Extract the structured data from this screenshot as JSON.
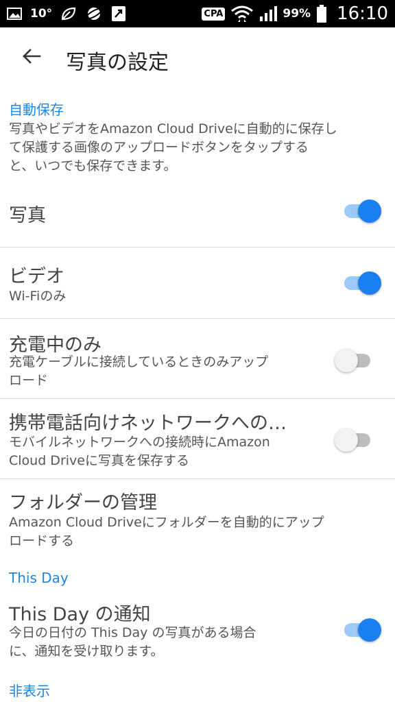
{
  "status_bar": {
    "temperature": "10°",
    "carrier": "CPA",
    "battery": "99%",
    "time": "16:10",
    "icons": [
      "image-icon",
      "leaf-icon",
      "planet-icon",
      "app-icon",
      "wifi-icon",
      "signal-icon",
      "battery-icon"
    ]
  },
  "toolbar": {
    "back_icon": "arrow-left-icon",
    "title": "写真の設定"
  },
  "auto_save": {
    "header": "自動保存",
    "description": "写真やビデオをAmazon Cloud Driveに自動的に保存して保護する画像のアップロードボタンをタップすると、いつでも保存できます。",
    "description_lines": [
      "写真やビデオをAmazon Cloud Driveに自動的に保存し",
      "て保護する画像のアップロードボタンをタップする",
      "と、いつでも保存できます。"
    ]
  },
  "settings": {
    "photos": {
      "title": "写真",
      "enabled": true
    },
    "video": {
      "title": "ビデオ",
      "subtitle": "Wi-Fiのみ",
      "enabled": true
    },
    "charging_only": {
      "title": "充電中のみ",
      "subtitle_lines": [
        "充電ケーブルに接続しているときのみアップ",
        "ロード"
      ],
      "enabled": false
    },
    "mobile_network": {
      "title": "携帯電話向けネットワークへの…",
      "subtitle_lines": [
        "モバイルネットワークへの接続時にAmazon",
        "Cloud Driveに写真を保存する"
      ],
      "enabled": false
    },
    "folder_management": {
      "title": "フォルダーの管理",
      "subtitle_lines": [
        "Amazon Cloud Driveにフォルダーを自動的にアップ",
        "ロードする"
      ]
    }
  },
  "this_day": {
    "header": "This Day",
    "notification": {
      "title": "This Day の通知",
      "subtitle_lines": [
        "今日の日付の This Day の写真がある場合",
        "に、通知を受け取ります。"
      ],
      "enabled": true
    }
  },
  "hidden": {
    "header": "非表示"
  },
  "colors": {
    "accent": "#1a86e6",
    "switch_on_thumb": "#1a7ff0",
    "switch_on_track": "#9cc9f5",
    "switch_off_thumb": "#f2f2f2",
    "switch_off_track": "#bdbdbd",
    "divider": "#dedede"
  }
}
